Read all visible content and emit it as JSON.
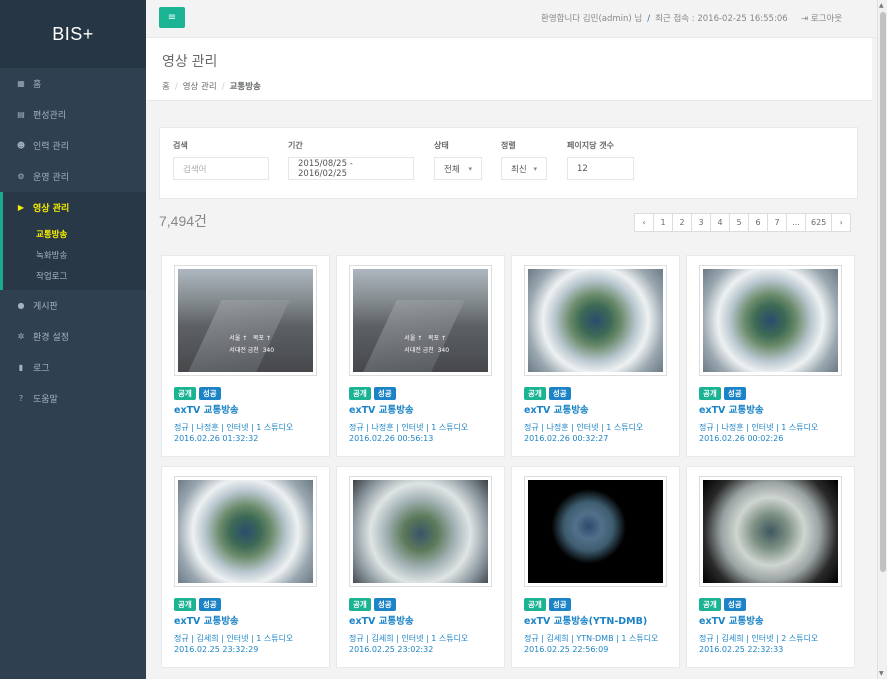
{
  "sidebar": {
    "logo": "BIS+",
    "items": [
      {
        "icon": "grid-icon",
        "glyph": "▦",
        "label": "홈"
      },
      {
        "icon": "calendar-icon",
        "glyph": "▤",
        "label": "편성관리"
      },
      {
        "icon": "users-icon",
        "glyph": "☻",
        "label": "인력 관리"
      },
      {
        "icon": "operation-icon",
        "glyph": "⚙",
        "label": "운영 관리"
      },
      {
        "icon": "video-icon",
        "glyph": "▶",
        "label": "영상 관리"
      },
      {
        "icon": "comment-icon",
        "glyph": "●",
        "label": "게시판"
      },
      {
        "icon": "gears-icon",
        "glyph": "✲",
        "label": "환경 설정"
      },
      {
        "icon": "book-icon",
        "glyph": "▮",
        "label": "로그"
      },
      {
        "icon": "question-icon",
        "glyph": "?",
        "label": "도움말"
      }
    ],
    "sub_items": [
      {
        "label": "교통방송"
      },
      {
        "label": "녹화방송"
      },
      {
        "label": "작업로그"
      }
    ]
  },
  "topbar": {
    "menu_glyph": "≡",
    "welcome": "환영합니다 김민(admin) 님",
    "sep": "/",
    "last_login": "최근 접속 : 2016-02-25 16:55:06",
    "logout": "⇥  로그아웃"
  },
  "header": {
    "title": "영상 관리",
    "breadcrumb": [
      "홈",
      "영상 관리",
      "교통방송"
    ],
    "div": "/"
  },
  "filter": {
    "search_label": "검색",
    "search_placeholder": "검색어",
    "period_label": "기간",
    "period_value": "2015/08/25 - 2016/02/25",
    "status_label": "상태",
    "status_value": "전체",
    "sort_label": "정렬",
    "sort_value": "최신",
    "per_page_label": "페이지당 갯수",
    "per_page_value": "12",
    "caret": "▾"
  },
  "result": {
    "count": "7,494건",
    "pages": [
      "‹",
      "1",
      "2",
      "3",
      "4",
      "5",
      "6",
      "7",
      "...",
      "625",
      "›"
    ]
  },
  "cards": [
    {
      "img": "traffic",
      "b1": "공개",
      "b2": "성공",
      "title": "exTV 교통방송",
      "meta": "정규 | 나정훈 | 인터넷 | 1 스튜디오",
      "date": "2016.02.26 01:32:32"
    },
    {
      "img": "traffic",
      "b1": "공개",
      "b2": "성공",
      "title": "exTV 교통방송",
      "meta": "정규 | 나정훈 | 인터넷 | 1 스튜디오",
      "date": "2016.02.26 00:56:13"
    },
    {
      "img": "earth-blur",
      "b1": "공개",
      "b2": "성공",
      "title": "exTV 교통방송",
      "meta": "정규 | 나정훈 | 인터넷 | 1 스튜디오",
      "date": "2016.02.26 00:32:27"
    },
    {
      "img": "earth-blur",
      "b1": "공개",
      "b2": "성공",
      "title": "exTV 교통방송",
      "meta": "정규 | 나정훈 | 인터넷 | 1 스튜디오",
      "date": "2016.02.26 00:02:26"
    },
    {
      "img": "earth-blur",
      "b1": "공개",
      "b2": "성공",
      "title": "exTV 교통방송",
      "meta": "정규 | 김세희 | 인터넷 | 1 스튜디오",
      "date": "2016.02.25 23:32:29"
    },
    {
      "img": "earth-blur2",
      "b1": "공개",
      "b2": "성공",
      "title": "exTV 교통방송",
      "meta": "정규 | 김세희 | 인터넷 | 1 스튜디오",
      "date": "2016.02.25 23:02:32"
    },
    {
      "img": "earth-dark",
      "b1": "공개",
      "b2": "성공",
      "title": "exTV 교통방송(YTN-DMB)",
      "meta": "정규 | 김세희 | YTN-DMB | 1 스튜디오",
      "date": "2016.02.25 22:56:09"
    },
    {
      "img": "earth-vig",
      "b1": "공개",
      "b2": "성공",
      "title": "exTV 교통방송",
      "meta": "정규 | 김세희 | 인터넷 | 2 스튜디오",
      "date": "2016.02.25 22:32:33"
    }
  ],
  "colors": {
    "sidebar_bg": "#2f4050",
    "accent_green": "#1ab394",
    "accent_blue": "#1c84c6",
    "active_yellow": "#f7ed00"
  }
}
